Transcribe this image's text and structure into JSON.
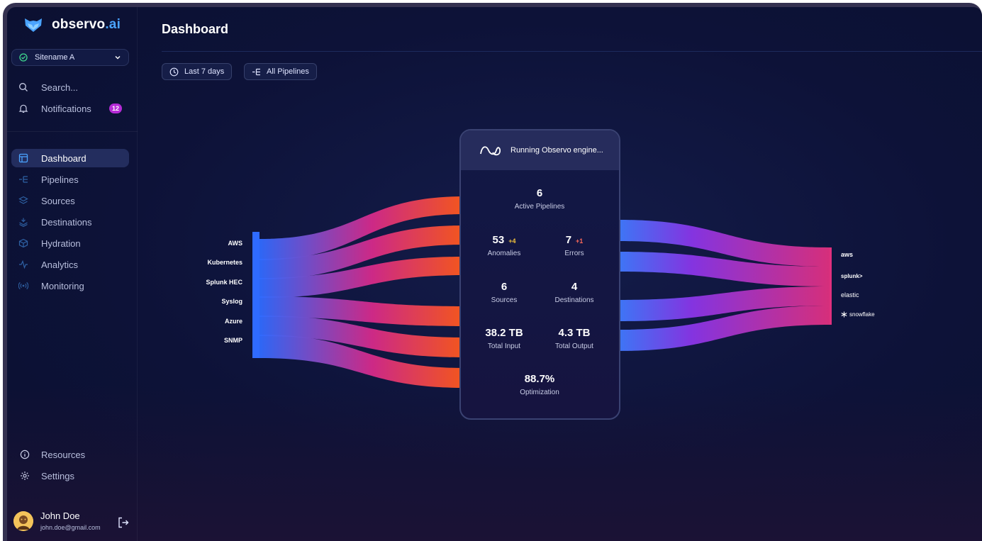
{
  "brand": {
    "name_main": "observo",
    "name_suffix": ".ai"
  },
  "site_selector": {
    "value": "Sitename A"
  },
  "sidebar": {
    "search_label": "Search...",
    "notifications_label": "Notifications",
    "notifications_count": "12",
    "items": [
      {
        "label": "Dashboard",
        "icon": "dashboard-icon",
        "active": true
      },
      {
        "label": "Pipelines",
        "icon": "pipelines-icon"
      },
      {
        "label": "Sources",
        "icon": "sources-icon"
      },
      {
        "label": "Destinations",
        "icon": "destinations-icon"
      },
      {
        "label": "Hydration",
        "icon": "hydration-icon"
      },
      {
        "label": "Analytics",
        "icon": "analytics-icon"
      },
      {
        "label": "Monitoring",
        "icon": "monitoring-icon"
      }
    ],
    "resources_label": "Resources",
    "settings_label": "Settings"
  },
  "user": {
    "name": "John Doe",
    "email": "john.doe@gmail.com"
  },
  "header": {
    "title": "Dashboard"
  },
  "filters": {
    "time_range": "Last 7 days",
    "pipelines": "All Pipelines"
  },
  "sources": [
    "AWS",
    "Kubernetes",
    "Splunk HEC",
    "Syslog",
    "Azure",
    "SNMP"
  ],
  "destinations": [
    "aws",
    "splunk>",
    "elastic",
    "snowflake"
  ],
  "engine": {
    "status": "Running Observo engine...",
    "active_pipelines": {
      "value": "6",
      "label": "Active Pipelines"
    },
    "anomalies": {
      "value": "53",
      "delta": "+4",
      "label": "Anomalies"
    },
    "errors": {
      "value": "7",
      "delta": "+1",
      "label": "Errors"
    },
    "sources": {
      "value": "6",
      "label": "Sources"
    },
    "destinations": {
      "value": "4",
      "label": "Destinations"
    },
    "total_input": {
      "value": "38.2 TB",
      "label": "Total Input"
    },
    "total_output": {
      "value": "4.3 TB",
      "label": "Total Output"
    },
    "optimization": {
      "value": "88.7%",
      "label": "Optimization"
    }
  },
  "colors": {
    "accent": "#4aa3ff",
    "flow_start": "#2f6bff",
    "flow_mid": "#d62a8a",
    "flow_end": "#ff5a1a",
    "badge": "#b52bd6"
  }
}
